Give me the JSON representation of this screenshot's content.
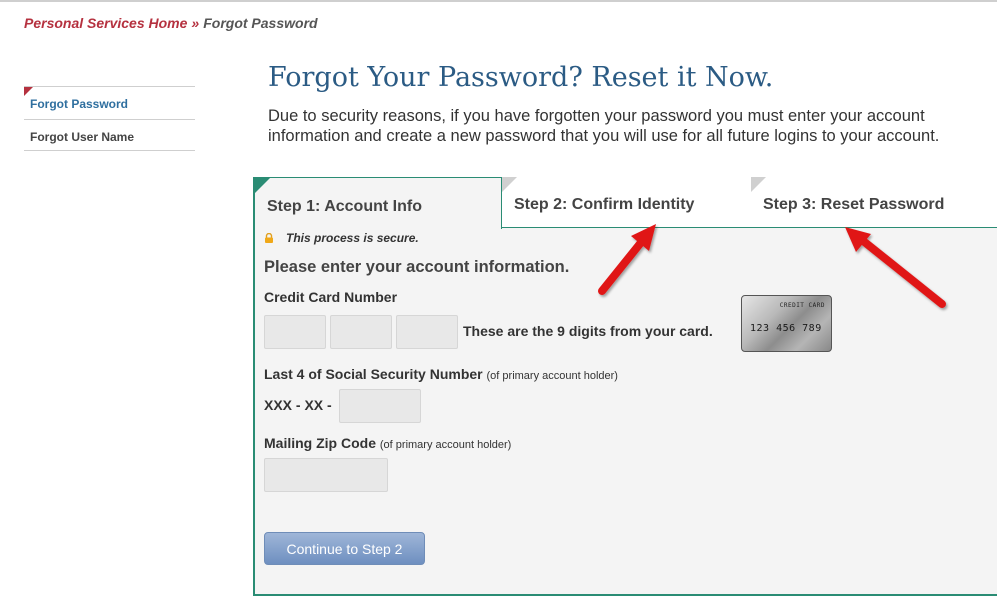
{
  "breadcrumb": {
    "home": "Personal Services Home",
    "separator": "»",
    "current": "Forgot Password"
  },
  "sidebar": {
    "items": [
      {
        "label": "Forgot Password",
        "active": true
      },
      {
        "label": "Forgot User Name",
        "active": false
      }
    ]
  },
  "page": {
    "title": "Forgot Your Password? Reset it Now.",
    "intro": "Due to security reasons, if you have forgotten your password you must enter your account information and create a new password that you will use for all future logins to your account."
  },
  "steps": {
    "tabs": [
      {
        "label": "Step 1: Account Info",
        "active": true
      },
      {
        "label": "Step 2: Confirm Identity",
        "active": false
      },
      {
        "label": "Step 3: Reset Password",
        "active": false
      }
    ]
  },
  "form": {
    "secure_notice": "This process is secure.",
    "prompt": "Please enter your account information.",
    "credit_card": {
      "label": "Credit Card Number",
      "hint": "These are the 9 digits from your card.",
      "values": [
        "",
        "",
        ""
      ]
    },
    "card_image": {
      "title": "CREDIT CARD",
      "number": "123 456 789"
    },
    "ssn": {
      "label": "Last 4 of Social Security Number",
      "note": "(of primary account holder)",
      "prefix": "XXX - XX -",
      "value": ""
    },
    "zip": {
      "label": "Mailing Zip Code",
      "note": "(of primary account holder)",
      "value": ""
    },
    "continue_label": "Continue to Step 2"
  },
  "colors": {
    "accent_red": "#b5313f",
    "link_blue": "#2f6f9f",
    "title_blue": "#2b5b84",
    "panel_green": "#2a8c74",
    "arrow_red": "#e01818"
  },
  "icons": [
    "lock-icon",
    "arrow-annotation"
  ]
}
